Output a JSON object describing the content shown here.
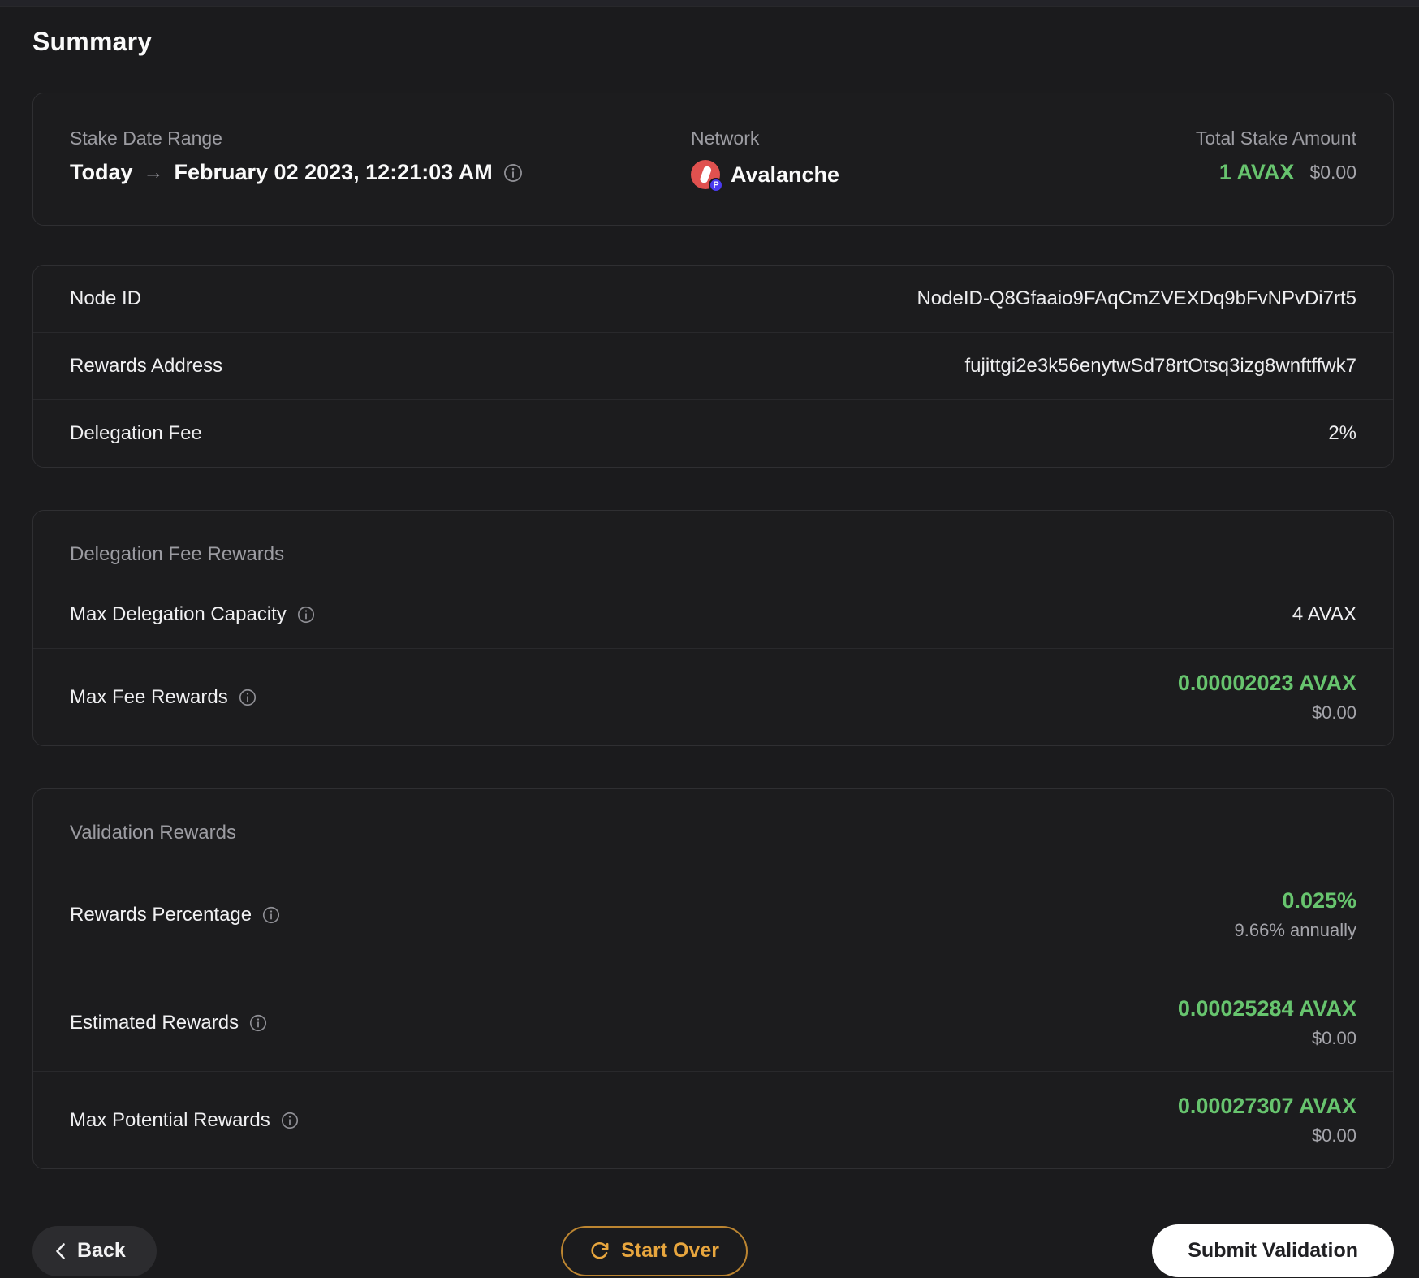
{
  "page": {
    "title": "Summary"
  },
  "colors": {
    "green": "#67C46E",
    "orange": "#E8A63E",
    "background": "#1b1b1d"
  },
  "overview": {
    "stake_date_range": {
      "label": "Stake Date Range",
      "from": "Today",
      "arrow": "→",
      "to": "February 02 2023, 12:21:03 AM"
    },
    "network": {
      "label": "Network",
      "name": "Avalanche",
      "badge": "P"
    },
    "total_stake": {
      "label": "Total Stake Amount",
      "amount": "1 AVAX",
      "usd": "$0.00"
    }
  },
  "details": {
    "rows": [
      {
        "label": "Node ID",
        "value": "NodeID-Q8Gfaaio9FAqCmZVEXDq9bFvNPvDi7rt5"
      },
      {
        "label": "Rewards Address",
        "value": "fujittgi2e3k56enytwSd78rtOtsq3izg8wnftffwk7"
      },
      {
        "label": "Delegation Fee",
        "value": "2%"
      }
    ]
  },
  "delegation_fee_rewards": {
    "title": "Delegation Fee Rewards",
    "capacity": {
      "label": "Max Delegation Capacity",
      "value": "4 AVAX"
    },
    "max_fee": {
      "label": "Max Fee Rewards",
      "value": "0.00002023 AVAX",
      "usd": "$0.00"
    }
  },
  "validation_rewards": {
    "title": "Validation Rewards",
    "percentage": {
      "label": "Rewards Percentage",
      "value": "0.025%",
      "sub": "9.66% annually"
    },
    "estimated": {
      "label": "Estimated Rewards",
      "value": "0.00025284 AVAX",
      "sub": "$0.00"
    },
    "max_potential": {
      "label": "Max Potential Rewards",
      "value": "0.00027307 AVAX",
      "sub": "$0.00"
    }
  },
  "footer": {
    "back_label": "Back",
    "start_over_label": "Start Over",
    "submit_label": "Submit Validation"
  }
}
